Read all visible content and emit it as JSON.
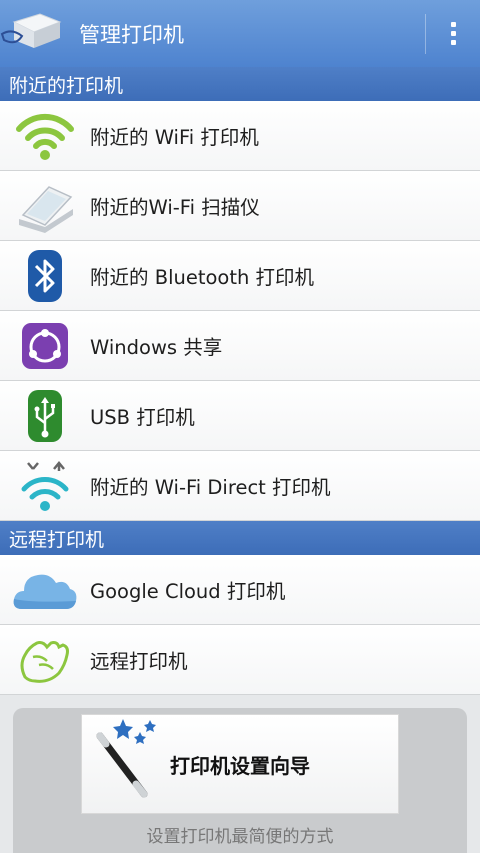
{
  "appbar": {
    "title": "管理打印机",
    "logo_icon": "printer-hand-icon",
    "menu_icon": "overflow-menu-icon",
    "color": "#5b8fd6"
  },
  "sections": {
    "nearby": "附近的打印机",
    "remote": "远程打印机"
  },
  "nearby_items": [
    {
      "label": "附近的 WiFi 打印机",
      "icon": "wifi-icon"
    },
    {
      "label": "附近的Wi-Fi 扫描仪",
      "icon": "scanner-icon"
    },
    {
      "label": "附近的 Bluetooth 打印机",
      "icon": "bluetooth-icon"
    },
    {
      "label": "Windows 共享",
      "icon": "windows-share-icon"
    },
    {
      "label": "USB 打印机",
      "icon": "usb-icon"
    },
    {
      "label": "附近的 Wi-Fi Direct 打印机",
      "icon": "wifi-direct-icon"
    }
  ],
  "remote_items": [
    {
      "label": "Google Cloud 打印机",
      "icon": "cloud-icon"
    },
    {
      "label": "远程打印机",
      "icon": "remote-hand-icon"
    }
  ],
  "wizard": {
    "label": "打印机设置向导",
    "subtitle": "设置打印机最简便的方式",
    "icon": "magic-wand-icon"
  },
  "colors": {
    "section_header": "#4676c0",
    "wifi_green": "#8cc63f",
    "bluetooth_blue": "#1f5aa8",
    "windows_purple": "#7b3fb0",
    "usb_green": "#2e8b2e",
    "wifi_direct_teal": "#2bb5c8",
    "cloud_blue": "#78b4e6"
  }
}
